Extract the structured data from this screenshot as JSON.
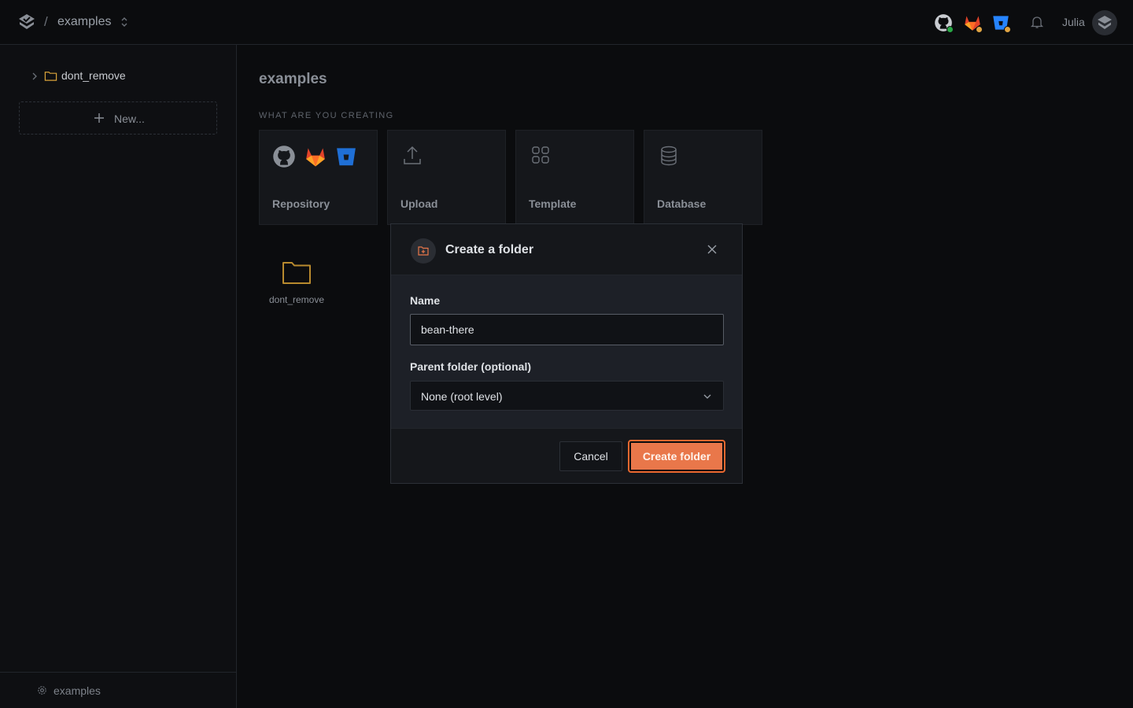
{
  "header": {
    "separator": "/",
    "project": "examples",
    "user": "Julia",
    "integrations": [
      "github-icon",
      "gitlab-icon",
      "bitbucket-icon"
    ],
    "status_colors": {
      "github": "#28a745",
      "gitlab": "#e0a443",
      "bitbucket": "#e0a443"
    }
  },
  "sidebar": {
    "tree": [
      {
        "label": "dont_remove",
        "icon": "folder-icon"
      }
    ],
    "new_label": "New...",
    "footer_label": "examples"
  },
  "main": {
    "title": "examples",
    "section_label": "WHAT ARE YOU CREATING",
    "cards": [
      {
        "label": "Repository",
        "icons": [
          "github-icon",
          "gitlab-icon",
          "bitbucket-icon"
        ]
      },
      {
        "label": "Upload",
        "icon": "upload-icon"
      },
      {
        "label": "Template",
        "icon": "template-grid-icon"
      },
      {
        "label": "Database",
        "icon": "database-icon"
      }
    ],
    "folders": [
      {
        "label": "dont_remove"
      }
    ]
  },
  "modal": {
    "title": "Create a folder",
    "name_label": "Name",
    "name_value": "bean-there",
    "parent_label": "Parent folder (optional)",
    "parent_value": "None (root level)",
    "cancel_label": "Cancel",
    "submit_label": "Create folder",
    "accent": "#e9774a"
  }
}
